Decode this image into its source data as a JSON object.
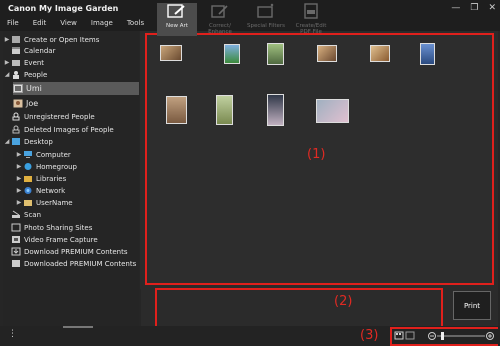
{
  "window": {
    "title": "Canon My Image Garden",
    "controls": [
      "—",
      "❐",
      "✕"
    ]
  },
  "menu": [
    "File",
    "Edit",
    "View",
    "Image",
    "Tools",
    "Help"
  ],
  "sidebar": {
    "items": [
      {
        "label": "Create or Open Items",
        "arrow": "▶"
      },
      {
        "label": "Calendar",
        "arrow": ""
      },
      {
        "label": "Event",
        "arrow": "▶"
      },
      {
        "label": "People",
        "arrow": "◢"
      },
      {
        "label": "Umi",
        "arrow": ""
      },
      {
        "label": "Joe",
        "arrow": ""
      },
      {
        "label": "Unregistered People",
        "arrow": ""
      },
      {
        "label": "Deleted Images of People",
        "arrow": ""
      },
      {
        "label": "Desktop",
        "arrow": "◢"
      },
      {
        "label": "Computer",
        "arrow": "▶"
      },
      {
        "label": "Homegroup",
        "arrow": "▶"
      },
      {
        "label": "Libraries",
        "arrow": "▶"
      },
      {
        "label": "Network",
        "arrow": "▶"
      },
      {
        "label": "UserName",
        "arrow": "▶"
      },
      {
        "label": "Scan",
        "arrow": ""
      },
      {
        "label": "Photo Sharing Sites",
        "arrow": ""
      },
      {
        "label": "Video Frame Capture",
        "arrow": ""
      },
      {
        "label": "Download PREMIUM Contents",
        "arrow": ""
      },
      {
        "label": "Downloaded PREMIUM Contents",
        "arrow": ""
      }
    ]
  },
  "callouts": {
    "one": "(1)",
    "two": "(2)",
    "three": "(3)"
  },
  "toolbar": {
    "new_art": "New Art",
    "correct": "Correct/ Enhance",
    "filters": "Special Filters",
    "pdf": "Create/Edit PDF File",
    "print": "Print"
  },
  "statusbar": {
    "menu_dots": "⋮"
  },
  "colors": {
    "accent_red": "#e0201c",
    "bg": "#262626",
    "selection": "#5a5a5a"
  }
}
